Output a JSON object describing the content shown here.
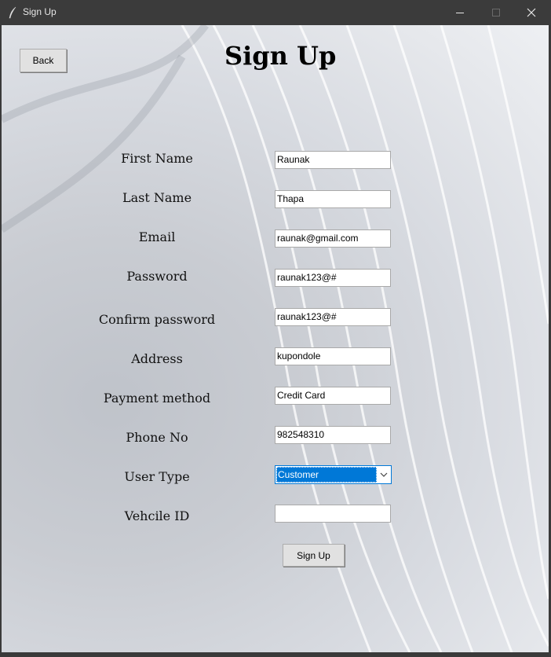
{
  "window": {
    "title": "Sign Up"
  },
  "page": {
    "heading": "Sign Up",
    "back_label": "Back",
    "submit_label": "Sign Up"
  },
  "form": {
    "first_name": {
      "label": "First Name",
      "value": "Raunak"
    },
    "last_name": {
      "label": "Last Name",
      "value": "Thapa"
    },
    "email": {
      "label": "Email",
      "value": "raunak@gmail.com"
    },
    "password": {
      "label": "Password",
      "value": "raunak123@#"
    },
    "confirm_password": {
      "label": "Confirm password",
      "value": "raunak123@#"
    },
    "address": {
      "label": "Address",
      "value": "kupondole"
    },
    "payment_method": {
      "label": "Payment method",
      "value": "Credit Card"
    },
    "phone": {
      "label": "Phone No",
      "value": "982548310"
    },
    "user_type": {
      "label": "User Type",
      "value": "Customer"
    },
    "vehicle_id": {
      "label": "Vehcile ID",
      "value": ""
    }
  },
  "colors": {
    "selection": "#0078d7",
    "titlebar": "#3b3b3b"
  }
}
